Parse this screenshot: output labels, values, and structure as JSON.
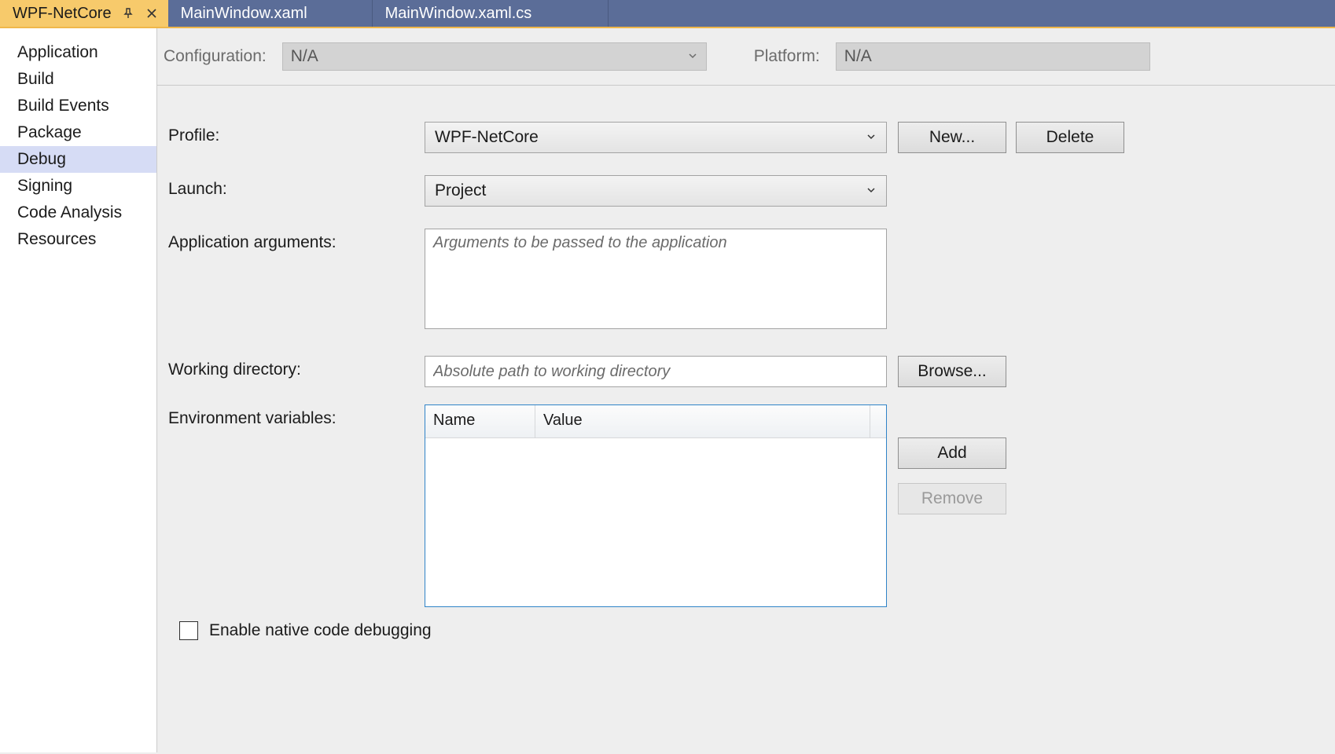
{
  "tabs": {
    "project": "WPF-NetCore",
    "docs": [
      "MainWindow.xaml",
      "MainWindow.xaml.cs"
    ]
  },
  "sidebar": {
    "items": [
      {
        "label": "Application"
      },
      {
        "label": "Build"
      },
      {
        "label": "Build Events"
      },
      {
        "label": "Package"
      },
      {
        "label": "Debug"
      },
      {
        "label": "Signing"
      },
      {
        "label": "Code Analysis"
      },
      {
        "label": "Resources"
      }
    ],
    "selected_index": 4
  },
  "configbar": {
    "configuration_label": "Configuration:",
    "configuration_value": "N/A",
    "platform_label": "Platform:",
    "platform_value": "N/A"
  },
  "form": {
    "profile_label": "Profile:",
    "profile_value": "WPF-NetCore",
    "new_btn": "New...",
    "delete_btn": "Delete",
    "launch_label": "Launch:",
    "launch_value": "Project",
    "args_label": "Application arguments:",
    "args_placeholder": "Arguments to be passed to the application",
    "workdir_label": "Working directory:",
    "workdir_placeholder": "Absolute path to working directory",
    "browse_btn": "Browse...",
    "env_label": "Environment variables:",
    "env_columns": {
      "name": "Name",
      "value": "Value"
    },
    "add_btn": "Add",
    "remove_btn": "Remove",
    "native_debug_label": "Enable native code debugging",
    "native_debug_checked": false
  }
}
